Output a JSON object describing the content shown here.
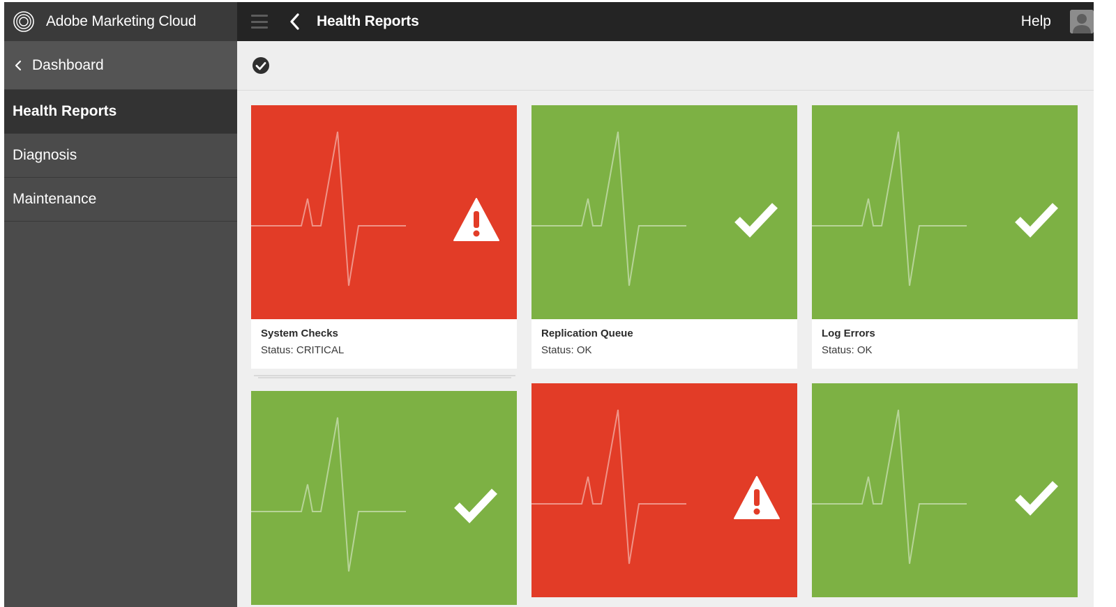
{
  "app": {
    "title": "Adobe Marketing Cloud"
  },
  "header": {
    "page_title": "Health Reports",
    "help_label": "Help"
  },
  "sidebar": {
    "back_label": "Dashboard",
    "items": [
      {
        "label": "Health Reports",
        "active": true
      },
      {
        "label": "Diagnosis",
        "active": false
      },
      {
        "label": "Maintenance",
        "active": false
      }
    ]
  },
  "cards": [
    {
      "name": "System Checks",
      "status": "Status: CRITICAL",
      "state": "critical"
    },
    {
      "name": "Replication Queue",
      "status": "Status: OK",
      "state": "ok"
    },
    {
      "name": "Log Errors",
      "status": "Status: OK",
      "state": "ok"
    },
    {
      "name": "",
      "status": "",
      "state": "ok"
    },
    {
      "name": "",
      "status": "",
      "state": "critical"
    },
    {
      "name": "",
      "status": "",
      "state": "ok"
    }
  ],
  "colors": {
    "critical": "#e23c27",
    "ok": "#7db144",
    "topbar": "#242424",
    "sidebar": "#4b4b4b"
  }
}
